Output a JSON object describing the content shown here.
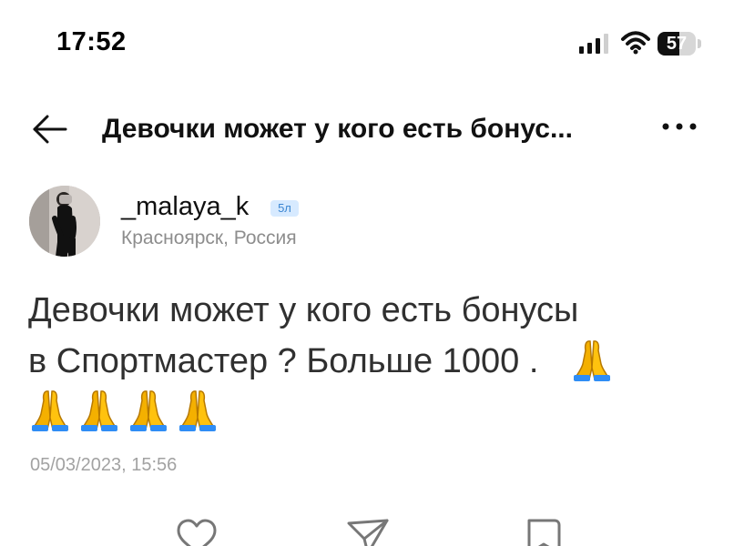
{
  "status_bar": {
    "time": "17:52",
    "battery_percent": 57,
    "battery_label": "57",
    "icons": [
      "signal-icon",
      "wifi-icon",
      "battery-icon"
    ]
  },
  "header": {
    "back_icon": "back-arrow-icon",
    "title": "Девочки может у кого есть бонус...",
    "more_icon": "more-icon"
  },
  "post": {
    "author": {
      "username": "_malaya_k",
      "badge": "5л",
      "location": "Красноярск, Россия"
    },
    "text_lines": [
      "Девочки может у кого есть бонусы",
      "в Спортмастер ? Больше 1000 ."
    ],
    "emoji_name": "folded-hands-icon",
    "emoji_count": 5,
    "date": "05/03/2023, 15:56"
  },
  "actions": [
    {
      "icon": "heart-icon"
    },
    {
      "icon": "send-icon"
    },
    {
      "icon": "bookmark-icon"
    }
  ],
  "colors": {
    "background": "#ffffff",
    "text": "#303030",
    "meta": "#8d8d8d",
    "badge_background": "#d7eaff",
    "badge_text": "#3c86d2",
    "emoji": "#f5b400"
  }
}
